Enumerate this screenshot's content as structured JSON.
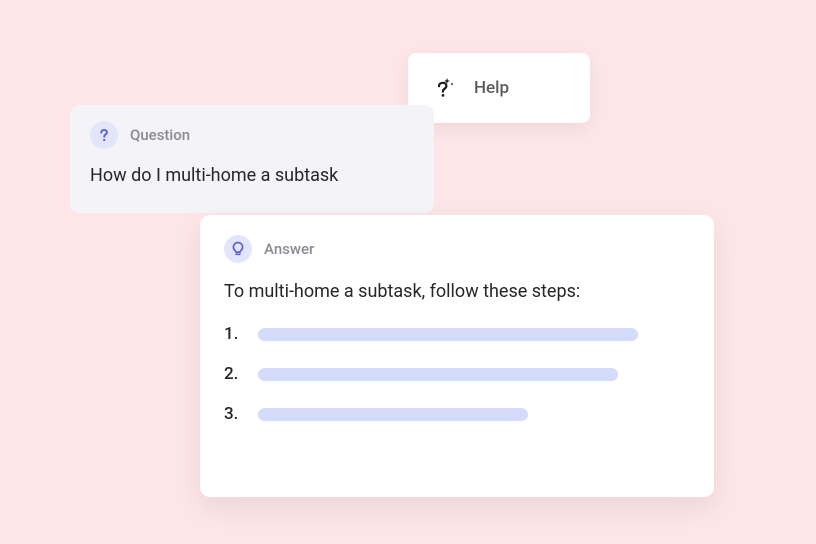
{
  "help": {
    "label": "Help"
  },
  "question": {
    "header_label": "Question",
    "text": "How do I multi-home a subtask"
  },
  "answer": {
    "header_label": "Answer",
    "text": "To multi-home a subtask, follow these steps:",
    "steps": [
      "1.",
      "2.",
      "3."
    ]
  }
}
